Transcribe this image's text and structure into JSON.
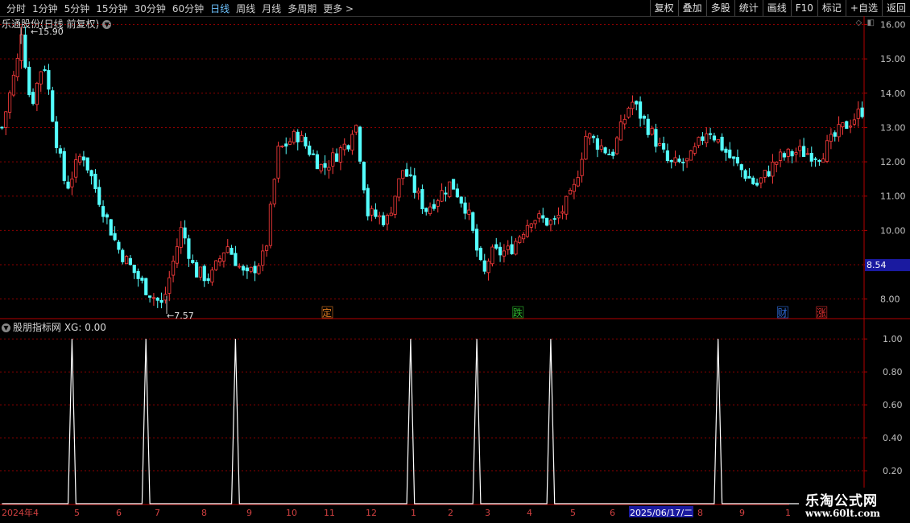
{
  "toolbar": {
    "periods": [
      "分时",
      "1分钟",
      "5分钟",
      "15分钟",
      "30分钟",
      "60分钟",
      "日线",
      "周线",
      "月线",
      "多周期",
      "更多 >"
    ],
    "active_period": "日线",
    "tools": [
      "复权",
      "叠加",
      "多股",
      "统计",
      "画线",
      "F10",
      "标记",
      "+自选",
      "返回"
    ]
  },
  "chart_title": "乐通股份(日线 前复权)",
  "indicator_title": "股朋指标网 XG: 0.00",
  "current_price_tag": "8.54",
  "high_annotation": "15.90",
  "low_annotation": "7.57",
  "event_markers": [
    {
      "label": "定",
      "color": "#e07b20",
      "bar": 84
    },
    {
      "label": "跌",
      "color": "#2fbf2f",
      "bar": 133
    },
    {
      "label": "财",
      "color": "#2f6fdf",
      "bar": 201
    },
    {
      "label": "涨",
      "color": "#e03030",
      "bar": 211
    }
  ],
  "date_axis": [
    "2024年4",
    "5",
    "6",
    "7",
    "8",
    "9",
    "10",
    "11",
    "12",
    "1",
    "2",
    "3",
    "4",
    "5",
    "6",
    "2025/06/17/二",
    "8",
    "9",
    "1"
  ],
  "cursor_date": "2025/06/17/二",
  "logo": {
    "line1": "乐淘公式网",
    "line2": "www.60lt.com"
  },
  "colors": {
    "up": "#ff3c3c",
    "down": "#54ffff",
    "axis": "#b40000",
    "grid": "#8b0000",
    "signal": "#ffffff"
  },
  "chart_data": [
    {
      "type": "candlestick",
      "title": "乐通股份(日线 前复权)",
      "ylim": [
        7.5,
        16.2
      ],
      "y_ticks": [
        8.0,
        9.0,
        10.0,
        11.0,
        12.0,
        13.0,
        14.0,
        15.0,
        16.0
      ],
      "high": 15.9,
      "low": 7.57,
      "last": 8.54
    },
    {
      "type": "line",
      "title": "股朋指标网 XG",
      "ylim": [
        0,
        1.05
      ],
      "y_ticks": [
        0.2,
        0.4,
        0.6,
        0.8,
        1.0
      ],
      "signal_bars": [
        18,
        37,
        60,
        105,
        122,
        141,
        184
      ],
      "signal_value": 1.0,
      "current_value": 0.0
    }
  ]
}
